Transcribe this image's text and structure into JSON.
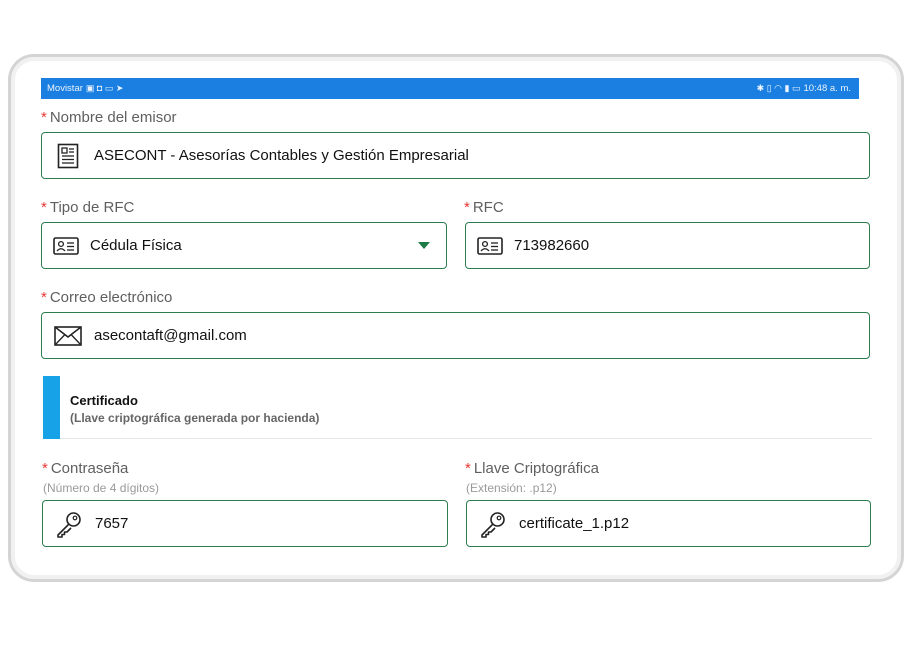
{
  "status_bar": {
    "carrier": "Movistar",
    "time": "10:48 a. m."
  },
  "fields": {
    "emisor": {
      "label": "Nombre del emisor",
      "value": "ASECONT - Asesorías Contables y Gestión Empresarial",
      "icon": "document-icon"
    },
    "tipo_rfc": {
      "label": "Tipo de RFC",
      "value": "Cédula Física",
      "icon": "id-card-icon"
    },
    "rfc": {
      "label": "RFC",
      "value": "713982660",
      "icon": "id-card-icon"
    },
    "correo": {
      "label": "Correo electrónico",
      "value": "asecontaft@gmail.com",
      "icon": "envelope-icon"
    },
    "contrasena": {
      "label": "Contraseña",
      "hint": "(Número de 4 dígitos)",
      "value": "7657",
      "icon": "key-icon"
    },
    "llave": {
      "label": "Llave Criptográfica",
      "hint": "(Extensión: .p12)",
      "value": "certificate_1.p12",
      "icon": "key-icon"
    }
  },
  "required_marker": "*",
  "section": {
    "title": "Certificado",
    "subtitle": "(Llave criptográfica generada por hacienda)"
  },
  "colors": {
    "status_bar": "#1a7fe0",
    "field_border": "#2e7d4f",
    "required": "#e53935",
    "section_accent": "#17a2e8"
  }
}
